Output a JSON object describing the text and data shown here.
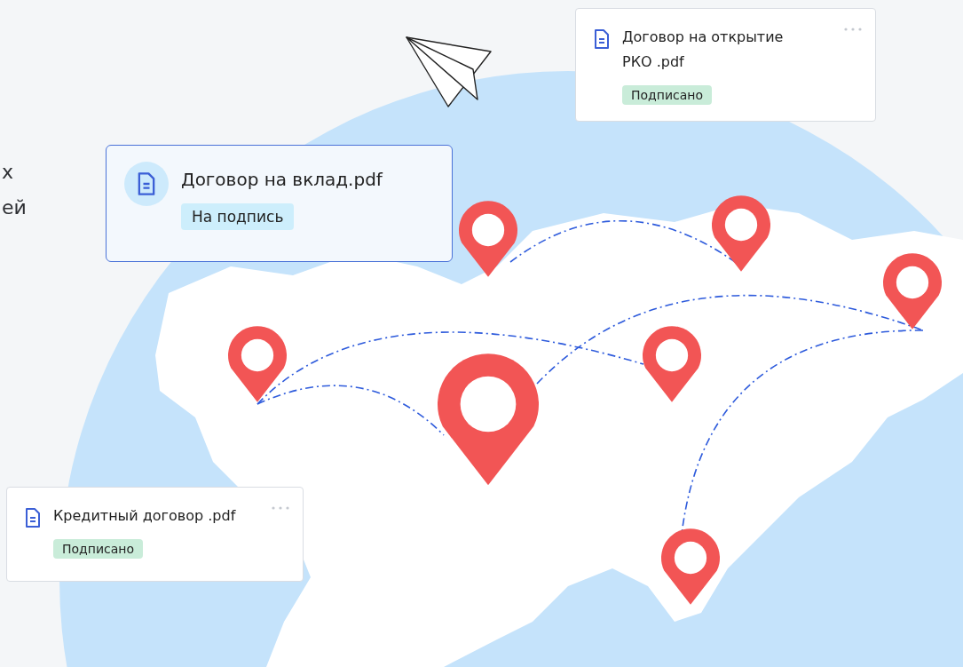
{
  "intro_lines": [
    "х",
    "ей"
  ],
  "cards": [
    {
      "title": "Договор на открытие РКО .pdf",
      "status": "Подписано",
      "awaiting_signature": false,
      "highlighted": false,
      "menu": true
    },
    {
      "title": "Договор на вклад.pdf",
      "status": "На подпись",
      "awaiting_signature": true,
      "highlighted": true,
      "menu": false
    },
    {
      "title": "Кредитный договор .pdf",
      "status": "Подписано",
      "awaiting_signature": false,
      "highlighted": false,
      "menu": true
    }
  ]
}
